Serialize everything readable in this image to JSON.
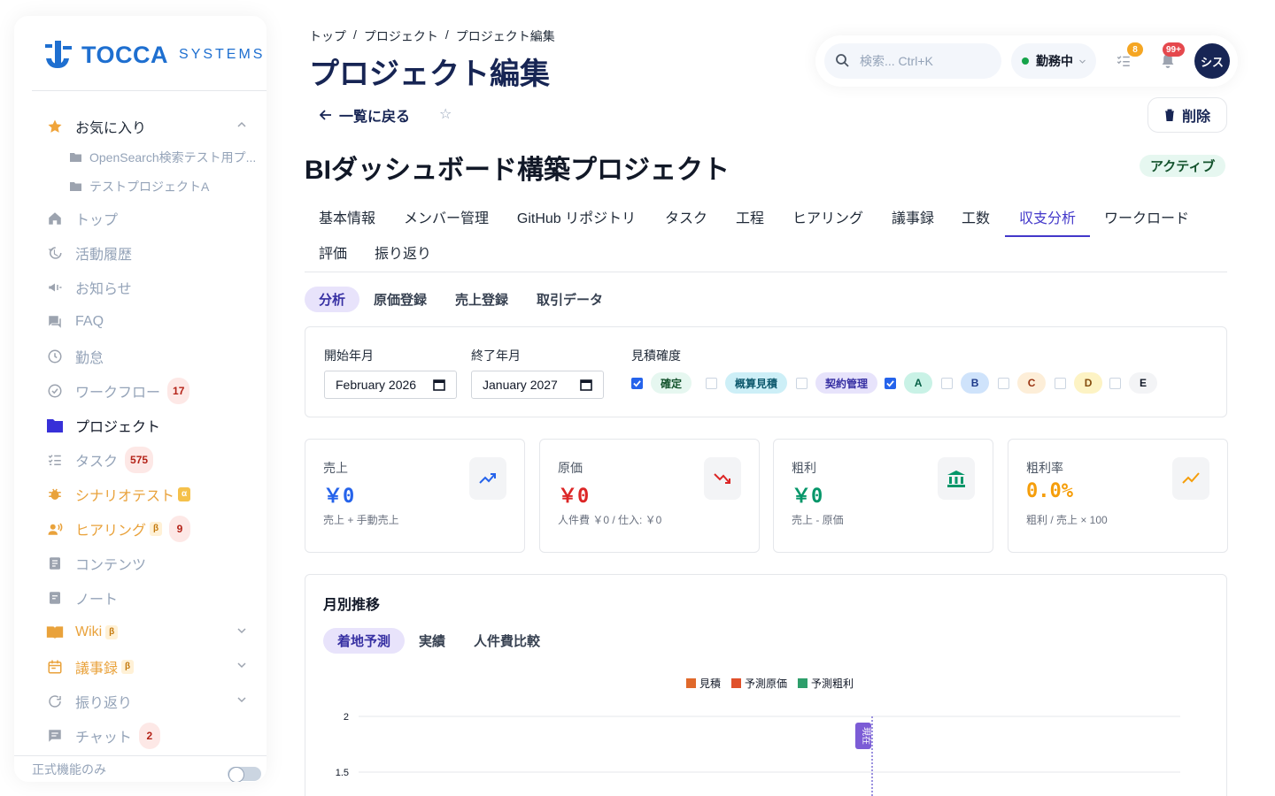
{
  "sidebar": {
    "brand": "TOCCA",
    "brand_sub": "SYSTEMS",
    "favorites_label": "お気に入り",
    "favorites": [
      "OpenSearch検索テスト用プ...",
      "テストプロジェクトA"
    ],
    "items": [
      {
        "label": "トップ",
        "icon": "home-icon"
      },
      {
        "label": "活動履歴",
        "icon": "history-icon"
      },
      {
        "label": "お知らせ",
        "icon": "megaphone-icon"
      },
      {
        "label": "FAQ",
        "icon": "faq-icon"
      },
      {
        "label": "勤怠",
        "icon": "clock-icon"
      },
      {
        "label": "ワークフロー",
        "icon": "check-circle-icon",
        "count": "17"
      },
      {
        "label": "プロジェクト",
        "icon": "folder-icon"
      },
      {
        "label": "タスク",
        "icon": "checklist-icon",
        "count": "575"
      },
      {
        "label": "シナリオテスト",
        "icon": "bug-icon",
        "tag": "α"
      },
      {
        "label": "ヒアリング",
        "icon": "hearing-icon",
        "tag": "β",
        "count": "9"
      },
      {
        "label": "コンテンツ",
        "icon": "document-icon"
      },
      {
        "label": "ノート",
        "icon": "note-icon"
      },
      {
        "label": "Wiki",
        "icon": "book-icon",
        "tag": "β"
      },
      {
        "label": "議事録",
        "icon": "calendar-icon",
        "tag": "β"
      },
      {
        "label": "振り返り",
        "icon": "refresh-icon"
      },
      {
        "label": "チャット",
        "icon": "chat-icon",
        "count": "2"
      }
    ],
    "footer_label": "正式機能のみ"
  },
  "header": {
    "breadcrumb": [
      "トップ",
      "/",
      "プロジェクト",
      "/",
      "プロジェクト編集"
    ],
    "title": "プロジェクト編集",
    "search_placeholder": "検索... Ctrl+K",
    "status": "勤務中",
    "task_badge": "8",
    "notify_badge": "99+",
    "avatar": "シス"
  },
  "actions": {
    "back": "一覧に戻る",
    "delete": "削除"
  },
  "project": {
    "title": "BIダッシュボード構築プロジェクト",
    "status": "アクティブ"
  },
  "tabs": [
    "基本情報",
    "メンバー管理",
    "GitHub リポジトリ",
    "タスク",
    "工程",
    "ヒアリング",
    "議事録",
    "工数",
    "収支分析",
    "ワークロード",
    "評価",
    "振り返り"
  ],
  "subtabs": [
    "分析",
    "原価登録",
    "売上登録",
    "取引データ"
  ],
  "filters": {
    "start_label": "開始年月",
    "start_value": "February 2026",
    "end_label": "終了年月",
    "end_value": "January 2027",
    "accuracy_label": "見積確度",
    "chips": [
      {
        "label": "確定",
        "checked": true,
        "bg": "#e6f7f0",
        "fg": "#14532d"
      },
      {
        "label": "概算見積",
        "checked": false,
        "bg": "#cdeff7",
        "fg": "#0e5a6e"
      },
      {
        "label": "契約管理",
        "checked": false,
        "bg": "#e7e3fb",
        "fg": "#3730a3"
      },
      {
        "label": "A",
        "checked": true,
        "bg": "#c9f2e6",
        "fg": "#065f46"
      },
      {
        "label": "B",
        "checked": false,
        "bg": "#cfe3fb",
        "fg": "#1e3a8a"
      },
      {
        "label": "C",
        "checked": false,
        "bg": "#fdeed8",
        "fg": "#9a3412"
      },
      {
        "label": "D",
        "checked": false,
        "bg": "#fdf3c4",
        "fg": "#854d0e"
      },
      {
        "label": "E",
        "checked": false,
        "bg": "#f3f4f6",
        "fg": "#111827"
      }
    ]
  },
  "kpis": [
    {
      "label": "売上",
      "value": "￥0",
      "sub": "売上 + 手動売上",
      "color": "#2563eb",
      "icon": "trending-up-icon"
    },
    {
      "label": "原価",
      "value": "￥0",
      "sub": "人件費 ￥0 / 仕入: ￥0",
      "color": "#dc2626",
      "icon": "trending-down-icon"
    },
    {
      "label": "粗利",
      "value": "￥0",
      "sub": "売上 - 原価",
      "color": "#059669",
      "icon": "bank-icon"
    },
    {
      "label": "粗利率",
      "value": "0.0%",
      "sub": "粗利 / 売上 × 100",
      "color": "#f59e0b",
      "icon": "trend-line-icon"
    }
  ],
  "monthly": {
    "title": "月別推移",
    "tabs": [
      "着地予測",
      "実績",
      "人件費比較"
    ]
  },
  "chart_data": {
    "type": "bar",
    "title": "",
    "series": [
      {
        "name": "見積",
        "color": "#e0692b",
        "values": []
      },
      {
        "name": "予測原価",
        "color": "#e0512b",
        "values": []
      },
      {
        "name": "予測粗利",
        "color": "#2e9e6b",
        "values": []
      }
    ],
    "y_ticks": [
      "2",
      "1.5"
    ],
    "ylim": [
      0,
      2
    ],
    "marker_label": "現在",
    "grid": true,
    "legend": "top"
  }
}
